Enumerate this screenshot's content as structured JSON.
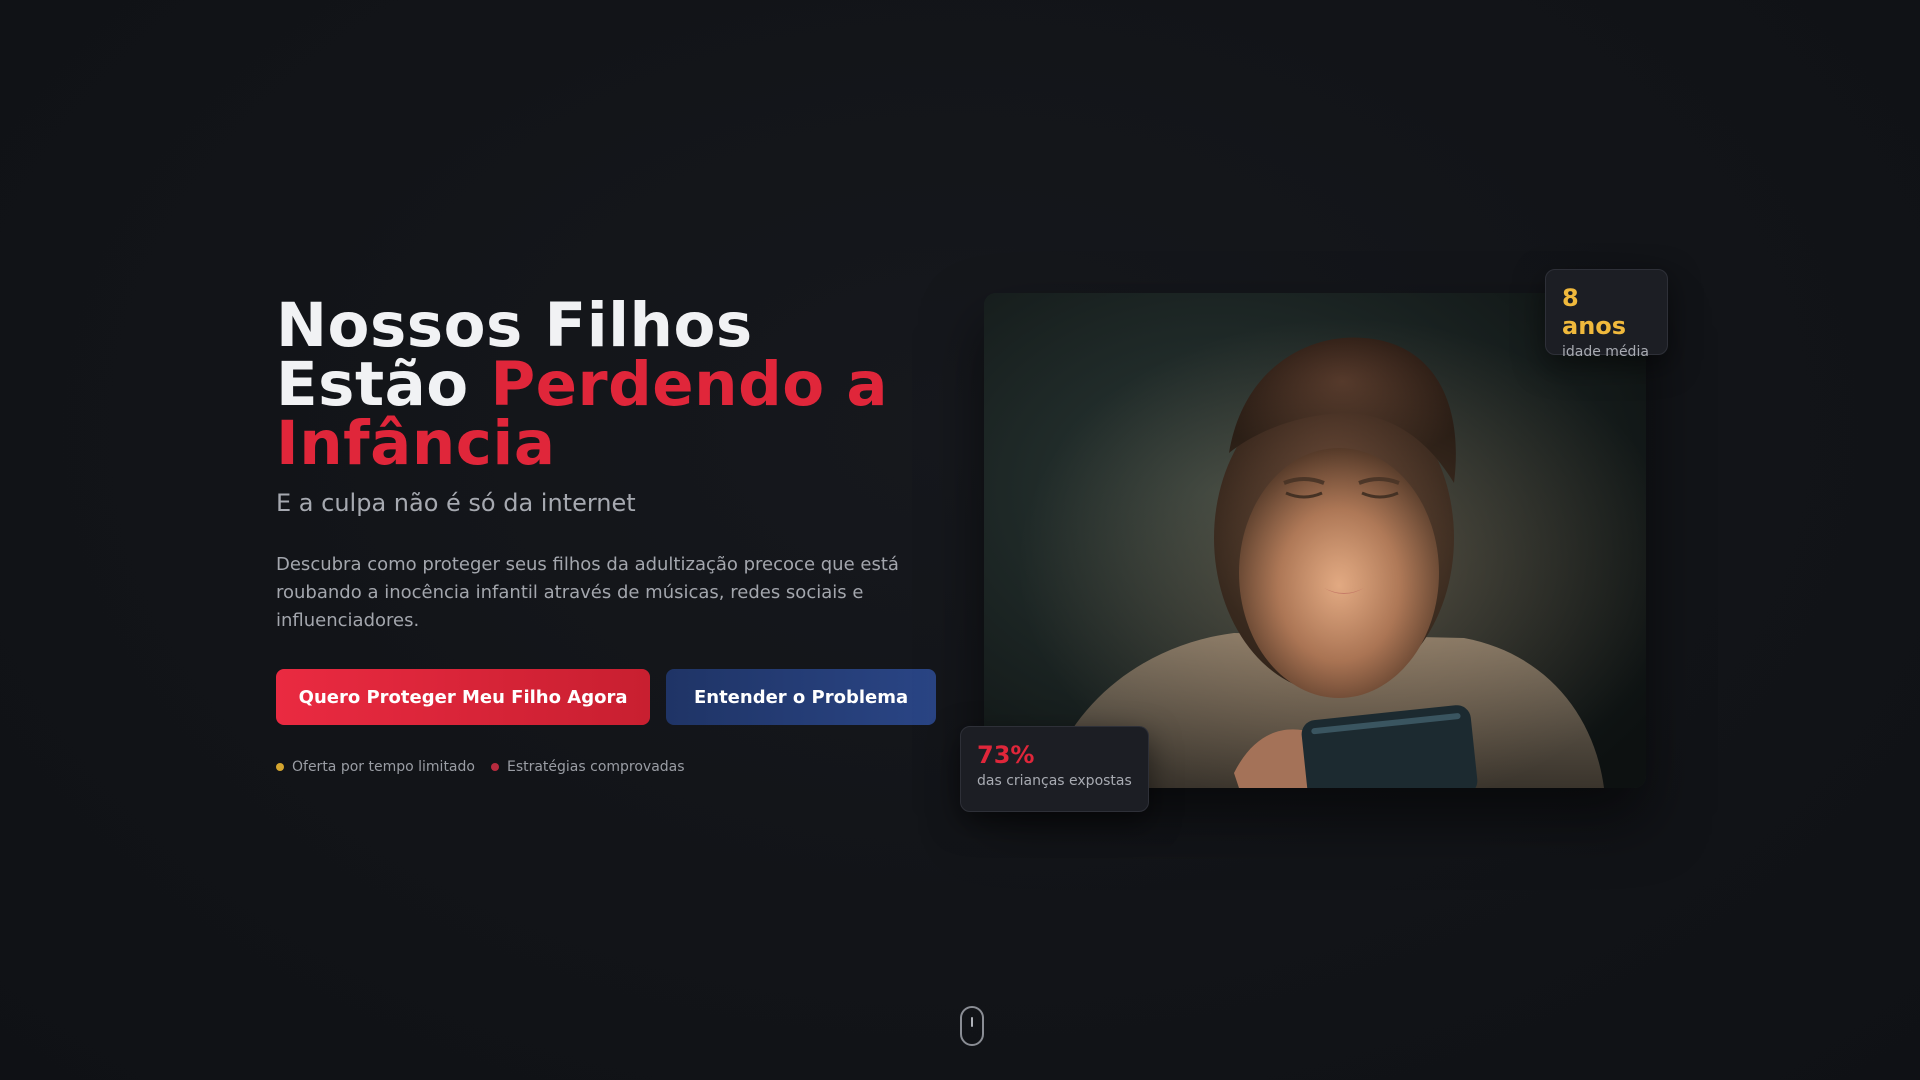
{
  "hero": {
    "headline_line1": "Nossos Filhos",
    "headline_line2_plain": "Estão ",
    "headline_line2_accent": "Perdendo a",
    "headline_line3_accent": "Infância",
    "subtitle": "E a culpa não é só da internet",
    "description": "Descubra como proteger seus filhos da adultização precoce que está roubando a inocência infantil através de músicas, redes sociais e influenciadores.",
    "primary_button": "Quero Proteger Meu Filho Agora",
    "secondary_button": "Entender o Problema",
    "badges": [
      {
        "label": "Oferta por tempo limitado",
        "color": "#d4a52f"
      },
      {
        "label": "Estratégias comprovadas",
        "color": "#b72b3e"
      }
    ]
  },
  "stats": {
    "top": {
      "value": "8 anos",
      "label": "idade média"
    },
    "bottom": {
      "value": "73%",
      "label": "das crianças expostas"
    }
  },
  "colors": {
    "accent_red": "#e0263a",
    "accent_gold": "#f0b93c",
    "secondary_blue": "#1f3466",
    "background": "#121418"
  },
  "image": {
    "description_icon": "child-with-phone-photo"
  }
}
